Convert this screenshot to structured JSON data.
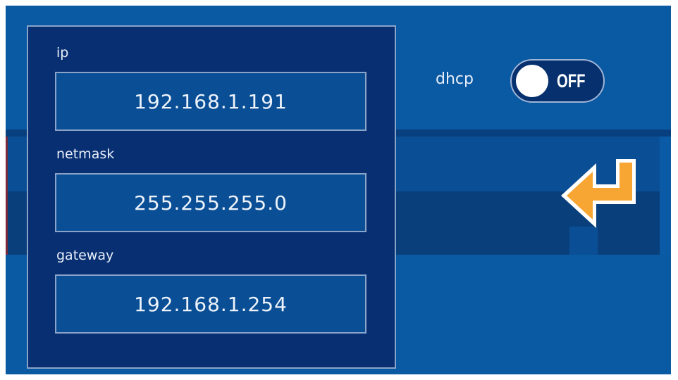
{
  "fields": [
    {
      "label": "ip",
      "value": "192.168.1.191"
    },
    {
      "label": "netmask",
      "value": "255.255.255.0"
    },
    {
      "label": "gateway",
      "value": "192.168.1.254"
    }
  ],
  "dhcp": {
    "label": "dhcp",
    "state": "OFF"
  },
  "icons": {
    "enter": "enter-arrow-icon"
  },
  "colors": {
    "background": "#0a59a3",
    "panel": "#082f72",
    "field": "#0a4f95",
    "border": "#8aa3c9",
    "accent": "#f7a633"
  }
}
